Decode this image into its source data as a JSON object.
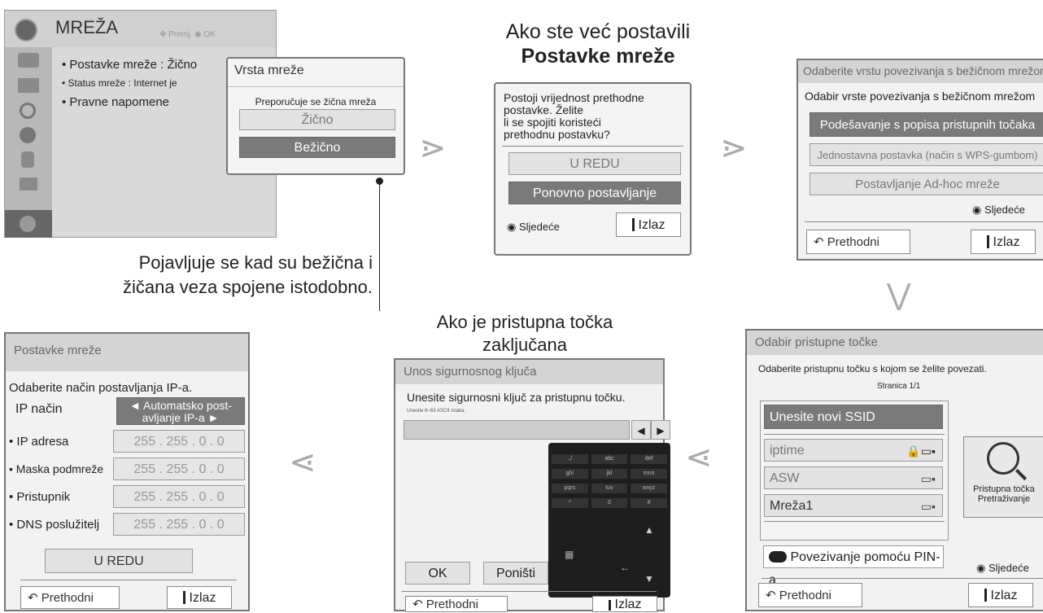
{
  "menu": {
    "title": "MREŽA",
    "hint_move": "Premj.",
    "hint_ok": "OK",
    "items": [
      "• Postavke mreže  : Žično",
      "• Status mreže        : Internet je",
      "• Pravne napomene"
    ]
  },
  "vrsta": {
    "title": "Vrsta mreže",
    "recommend": "Preporučuje se žična mreža",
    "wired": "Žično",
    "wireless": "Bežično"
  },
  "caption_both": [
    "Pojavljuje se kad su bežična i",
    "žičana veza spojene istodobno."
  ],
  "already": {
    "heading1": "Ako ste već postavili",
    "heading2": "Postavke mreže",
    "message": [
      "Postoji vrijednost prethodne",
      "postavke. Želite",
      "li se spojiti koristeći",
      "prethodnu postavku?"
    ],
    "ok": "U REDU",
    "reset": "Ponovno postavljanje",
    "next": "Sljedeće",
    "exit": "Izlaz"
  },
  "conntype": {
    "title": "Odaberite vrstu povezivanja s bežičnom mrežom",
    "subtitle": "Odabir vrste povezivanja s bežičnom mrežom",
    "opt1": "Podešavanje s popisa pristupnih točaka",
    "opt2": "Jednostavna postavka (način s WPS-gumbom)",
    "opt3": "Postavljanje Ad-hoc mreže",
    "next": "Sljedeće",
    "prev": "Prethodni",
    "exit": "Izlaz"
  },
  "ap": {
    "title": "Odabir pristupne točke",
    "subtitle": "Odaberite pristupnu točku s kojom se želite povezati.",
    "page": "Stranica 1/1",
    "new_ssid": "Unesite novi SSID",
    "networks": [
      "iptime",
      "ASW",
      "Mreža1"
    ],
    "pin": "Povezivanje pomoću PIN-a",
    "search": [
      "Pristupna točka",
      "Pretraživanje"
    ],
    "next": "Sljedeće",
    "prev": "Prethodni",
    "exit": "Izlaz"
  },
  "locked": {
    "heading1": "Ako je pristupna točka",
    "heading2": "zaključana",
    "title": "Unos sigurnosnog ključa",
    "subtitle": "Unesite sigurnosni ključ za pristupnu točku.",
    "hint": "Unesite 8~63 ASCII znaka.",
    "keys": [
      ".,/",
      "abc",
      "def",
      "ghi",
      "jkl",
      "mno",
      "pqrs",
      "tuv",
      "wxyz",
      "*",
      "0",
      "#"
    ],
    "ok": "OK",
    "cancel": "Poništi",
    "prev": "Prethodni",
    "exit": "Izlaz"
  },
  "ipset": {
    "title": "Postavke mreže",
    "subtitle": "Odaberite način postavljanja IP-a.",
    "mode_label": "IP način",
    "mode_value": [
      "◄ Automatsko post-",
      "avljanje IP-a ►"
    ],
    "rows": [
      {
        "label": "• IP adresa",
        "value": "255 . 255 . 0 . 0"
      },
      {
        "label": "• Maska podmreže",
        "value": "255 . 255 . 0 . 0"
      },
      {
        "label": "• Pristupnik",
        "value": "255 . 255 . 0 . 0"
      },
      {
        "label": "• DNS poslužitelj",
        "value": "255 . 255 . 0 . 0"
      }
    ],
    "ok": "U REDU",
    "prev": "Prethodni",
    "exit": "Izlaz"
  },
  "arrows": {
    "right": "⋗",
    "down": "⋁",
    "left": "⋖"
  }
}
